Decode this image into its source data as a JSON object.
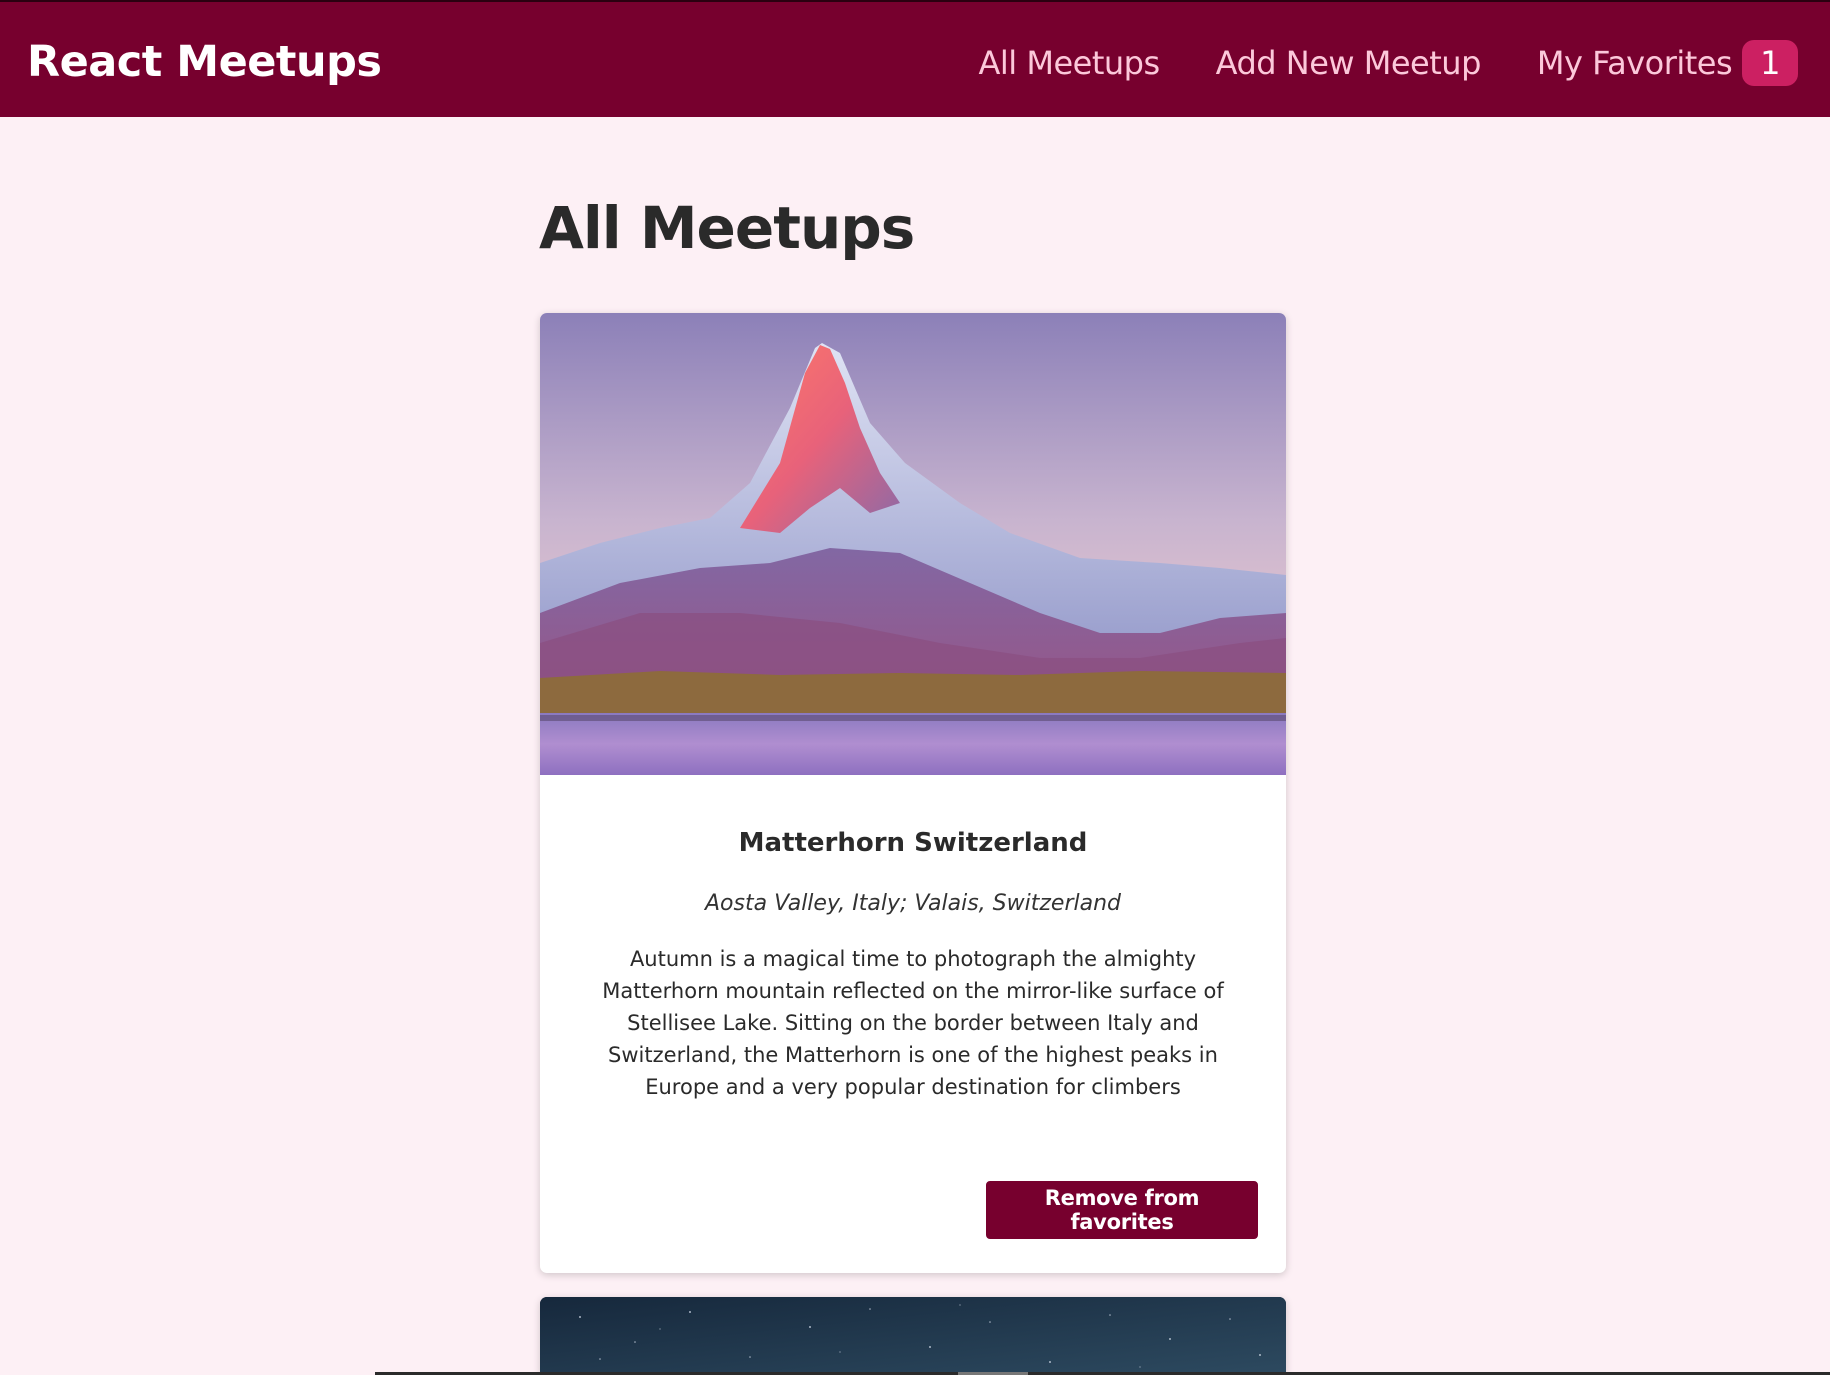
{
  "header": {
    "logo": "React Meetups",
    "nav": {
      "all_meetups": "All Meetups",
      "add_new_meetup": "Add New Meetup",
      "my_favorites": "My Favorites",
      "favorites_count": "1"
    }
  },
  "main": {
    "title": "All Meetups",
    "meetups": [
      {
        "title": "Matterhorn Switzerland",
        "address": "Aosta Valley, Italy; Valais, Switzerland",
        "description": "Autumn is a magical time to photograph the almighty Matterhorn mountain reflected on the mirror-like surface of Stellisee Lake. Sitting on the border between Italy and Switzerland, the Matterhorn is one of the highest peaks in Europe and a very popular destination for climbers",
        "button_label": "Remove from favorites"
      }
    ]
  },
  "colors": {
    "header_bg": "#77002e",
    "page_bg": "#fdf0f5",
    "nav_link": "#fcc8da",
    "badge_bg": "#cc2062",
    "button_bg": "#77002e"
  }
}
